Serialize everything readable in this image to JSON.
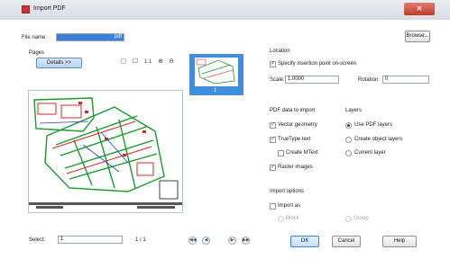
{
  "window": {
    "title": "Import PDF",
    "close_glyph": "✕"
  },
  "file": {
    "label": "File name:",
    "value": "pdf",
    "browse_label": "Browse..."
  },
  "pages": {
    "label": "Pages",
    "details_label": "Details >>",
    "tools": [
      "select-tool-icon",
      "pan-tool-icon",
      "zoom-1to1-icon",
      "zoom-in-icon",
      "zoom-out-icon"
    ],
    "tool_glyphs": [
      "▢",
      "☐",
      "1:1",
      "⊕",
      "⊖"
    ],
    "thumb_number": "1",
    "select_label": "Select:",
    "select_value": "1",
    "page_count": "1 / 1",
    "nav_glyphs": [
      "◀◀",
      "◀",
      "▶",
      "▶▶"
    ]
  },
  "location": {
    "label": "Location",
    "specify_label": "Specify insertion point on-screen",
    "specify_checked": true,
    "scale_label": "Scale:",
    "scale_value": "1.0000",
    "rotation_label": "Rotation:",
    "rotation_value": "0"
  },
  "pdf_data": {
    "label": "PDF data to import",
    "vector_label": "Vector geometry",
    "vector_checked": true,
    "truetype_label": "TrueType text",
    "truetype_checked": true,
    "mtext_label": "Create MText",
    "mtext_checked": false,
    "raster_label": "Raster images",
    "raster_checked": true
  },
  "layers": {
    "label": "Layers",
    "use_pdf_label": "Use PDF layers",
    "create_object_label": "Create object layers",
    "current_layer_label": "Current layer",
    "selected": "Use PDF layers"
  },
  "import_options": {
    "label": "Import options",
    "import_as_label": "Import as",
    "import_as_checked": false,
    "block_label": "Block",
    "group_label": "Group"
  },
  "buttons": {
    "ok": "OK",
    "cancel": "Cancel",
    "help": "Help"
  },
  "colors": {
    "accent": "#3b7fd6",
    "close": "#c23c2b"
  }
}
